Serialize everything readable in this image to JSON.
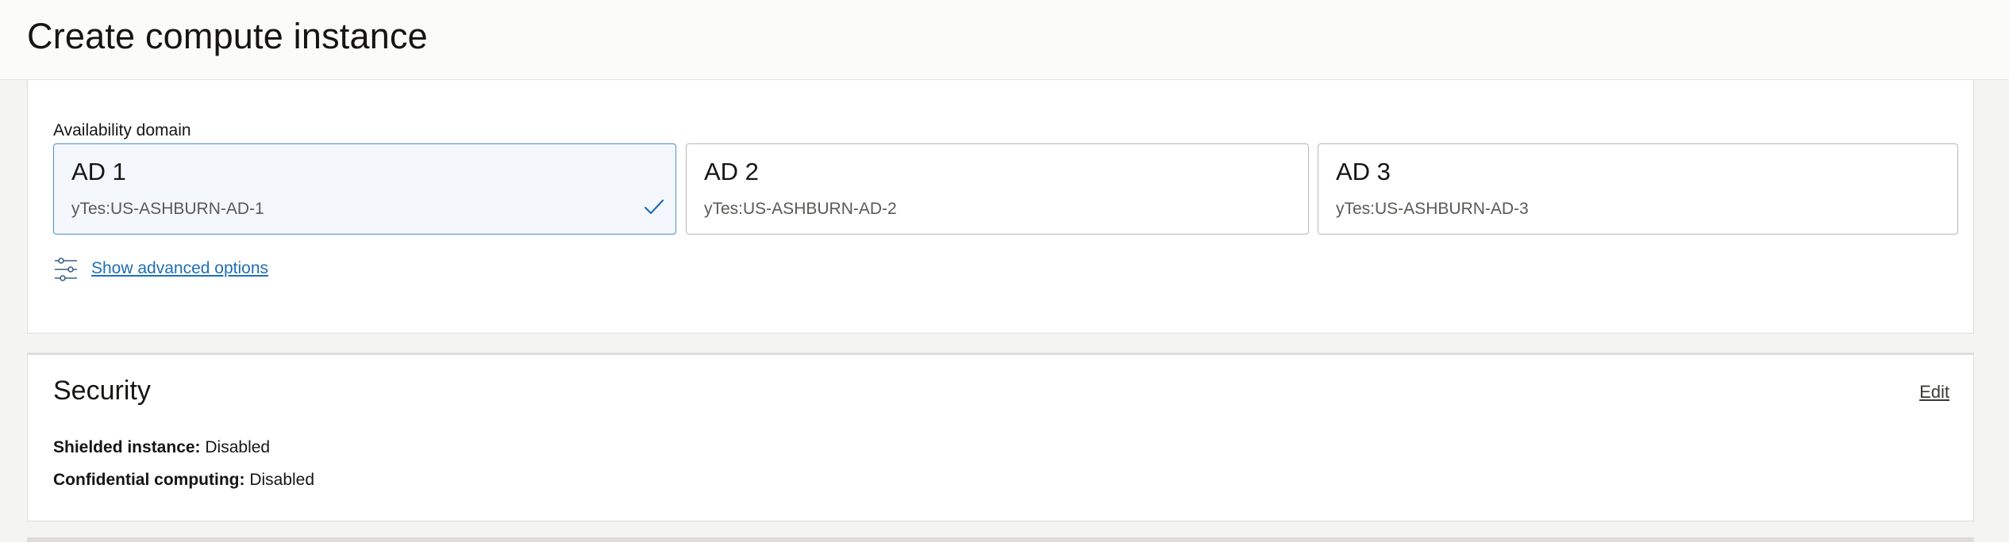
{
  "header": {
    "title": "Create compute instance"
  },
  "placement": {
    "cut_text": "",
    "availability_domain_label": "Availability domain",
    "domains": [
      {
        "title": "AD 1",
        "subtitle": "yTes:US-ASHBURN-AD-1",
        "selected": true
      },
      {
        "title": "AD 2",
        "subtitle": "yTes:US-ASHBURN-AD-2",
        "selected": false
      },
      {
        "title": "AD 3",
        "subtitle": "yTes:US-ASHBURN-AD-3",
        "selected": false
      }
    ],
    "advanced_link": "Show advanced options"
  },
  "security": {
    "title": "Security",
    "edit_label": "Edit",
    "shielded_label": "Shielded instance:",
    "shielded_value": "Disabled",
    "confidential_label": "Confidential computing:",
    "confidential_value": "Disabled"
  },
  "colors": {
    "accent": "#1f6fb5",
    "selected_border": "#4c8fd0",
    "check": "#1f6fb5"
  },
  "icons": {
    "selected": "check-icon",
    "advanced": "sliders-icon"
  }
}
